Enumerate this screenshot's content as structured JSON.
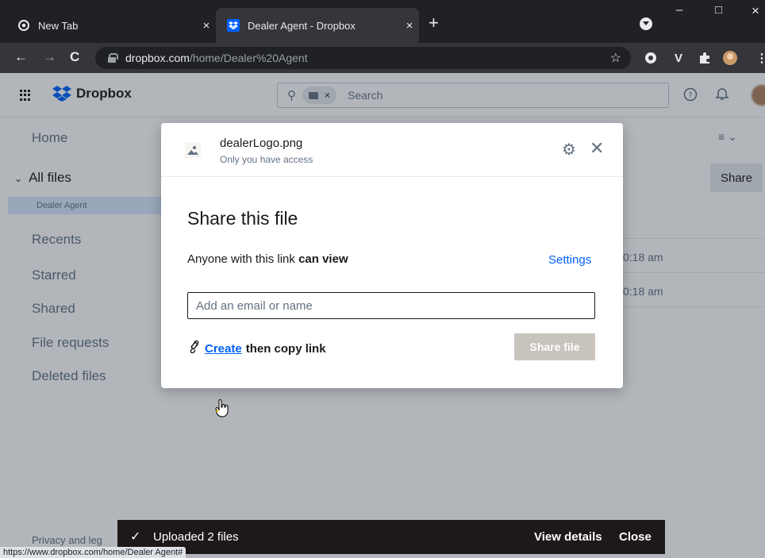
{
  "browser": {
    "tabs": [
      {
        "title": "New Tab",
        "close": "×"
      },
      {
        "title": "Dealer Agent - Dropbox",
        "close": "×"
      }
    ],
    "new_tab": "+",
    "window_controls": {
      "minimize": "–",
      "maximize": "□",
      "close": "×"
    },
    "url_host": "dropbox.com",
    "url_path": "/home/Dealer%20Agent",
    "status_url": "https://www.dropbox.com/home/Dealer Agent#",
    "icons": [
      "back-arrow-icon",
      "forward-arrow-icon",
      "reload-icon",
      "lock-icon",
      "bookmark-star-icon"
    ]
  },
  "header": {
    "brand": "Dropbox",
    "search_placeholder": "Search",
    "scope_close": "×",
    "help": "?",
    "bell": "🔔"
  },
  "sidebar": {
    "items": [
      {
        "label": "Home"
      },
      {
        "label": "All files"
      },
      {
        "label": "Recents"
      },
      {
        "label": "Starred"
      },
      {
        "label": "Shared"
      },
      {
        "label": "File requests"
      },
      {
        "label": "Deleted files"
      }
    ],
    "current_folder": "Dealer Agent",
    "privacy": "Privacy and leg"
  },
  "main": {
    "share_button": "Share",
    "rows": [
      {
        "time": "0:18 am"
      },
      {
        "time": "0:18 am"
      }
    ]
  },
  "modal": {
    "file_name": "dealerLogo.png",
    "access": "Only you have access",
    "title": "Share this file",
    "permission_prefix": "Anyone with this link ",
    "permission_value": "can view",
    "settings": "Settings",
    "email_placeholder": "Add an email or name",
    "create": "Create",
    "then_copy": "then copy link",
    "share_file": "Share file"
  },
  "toast": {
    "message": "Uploaded 2 files",
    "view_details": "View details",
    "close": "Close"
  },
  "colors": {
    "accent": "#0061fe",
    "chrome_dark": "#202124",
    "toast_bg": "#1e1919",
    "disabled_button": "#c8c4bd"
  }
}
